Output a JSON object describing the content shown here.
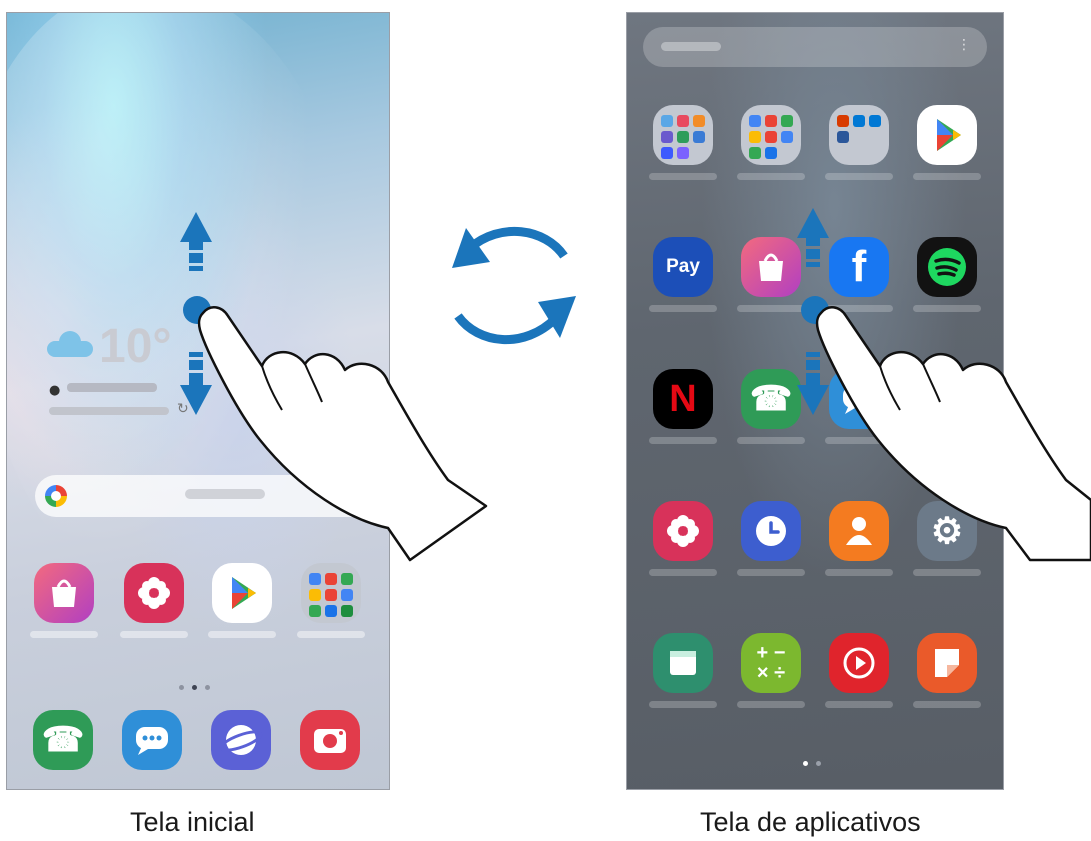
{
  "captions": {
    "home": "Tela inicial",
    "apps": "Tela de aplicativos"
  },
  "home_screen": {
    "weather_temp": "10°",
    "dock": [
      "phone-icon",
      "messages-icon",
      "internet-icon",
      "camera-icon"
    ],
    "favorites": [
      "galaxy-store-icon",
      "gallery-icon",
      "play-store-icon",
      "google-folder-icon"
    ]
  },
  "apps_screen": {
    "pay_label": "Pay",
    "netflix_letter": "N",
    "facebook_letter": "f",
    "rows": [
      [
        "folder-icon",
        "google-folder-icon",
        "microsoft-folder-icon",
        "play-store-icon"
      ],
      [
        "samsung-pay-icon",
        "galaxy-store-icon",
        "facebook-icon",
        "spotify-icon"
      ],
      [
        "netflix-icon",
        "phone-icon",
        "messages-icon",
        ""
      ],
      [
        "gallery-icon",
        "clock-icon",
        "contacts-icon",
        "settings-icon"
      ],
      [
        "calendar-icon",
        "calculator-icon",
        "video-icon",
        "notes-icon"
      ]
    ]
  },
  "colors": {
    "arrow_blue": "#1b75bb",
    "gesture_blue": "#1b75bb"
  }
}
